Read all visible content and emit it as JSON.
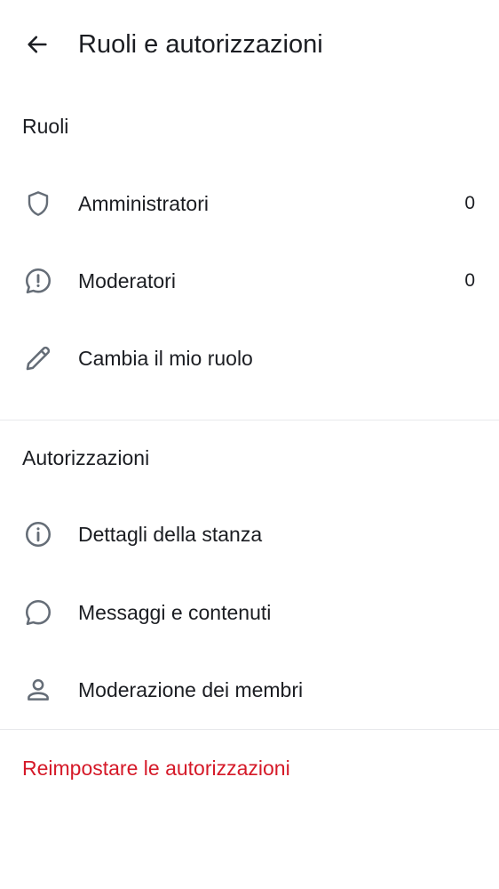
{
  "header": {
    "title": "Ruoli e autorizzazioni",
    "back_icon": "arrow-left-icon"
  },
  "roles_section": {
    "title": "Ruoli",
    "items": [
      {
        "label": "Amministratori",
        "count": "0",
        "icon": "shield-icon"
      },
      {
        "label": "Moderatori",
        "count": "0",
        "icon": "chat-alert-icon"
      },
      {
        "label": "Cambia il mio ruolo",
        "icon": "pencil-icon"
      }
    ]
  },
  "permissions_section": {
    "title": "Autorizzazioni",
    "items": [
      {
        "label": "Dettagli della stanza",
        "icon": "info-icon"
      },
      {
        "label": "Messaggi e contenuti",
        "icon": "chat-bubble-icon"
      },
      {
        "label": "Moderazione dei membri",
        "icon": "user-icon"
      }
    ]
  },
  "reset": {
    "label": "Reimpostare le autorizzazioni",
    "color": "#d51928"
  },
  "colors": {
    "icon": "#656d77",
    "text": "#1b1d22",
    "divider": "#e8e9ec"
  }
}
